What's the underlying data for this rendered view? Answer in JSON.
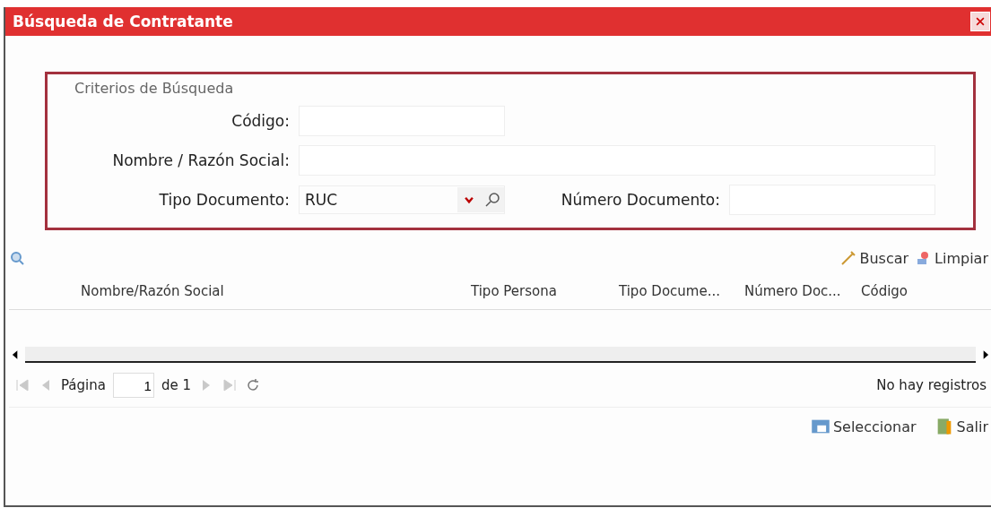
{
  "window": {
    "title": "Búsqueda de Contratante"
  },
  "criteria": {
    "legend": "Criterios de Búsqueda",
    "fields": [
      {
        "kind": "text",
        "label": "Código:"
      },
      {
        "kind": "text",
        "label": "Nombre / Razón Social:"
      },
      {
        "kind": "select",
        "label": "Tipo Documento:",
        "value": "RUC",
        "side_label": "Número Documento:"
      }
    ]
  },
  "toolbar": {
    "buttons": [
      {
        "label": "Buscar"
      },
      {
        "label": "Limpiar"
      }
    ]
  },
  "table": {
    "columns": [
      "Nombre/Razón Social",
      "Tipo Persona",
      "Tipo Docume...",
      "Número Doc...",
      "Código"
    ]
  },
  "pager": {
    "page_label": "Página",
    "page": "1",
    "of": "de 1",
    "disabled": true,
    "status": "No hay registros"
  },
  "footer": {
    "buttons": [
      {
        "label": "Seleccionar"
      },
      {
        "label": "Salir"
      }
    ]
  }
}
